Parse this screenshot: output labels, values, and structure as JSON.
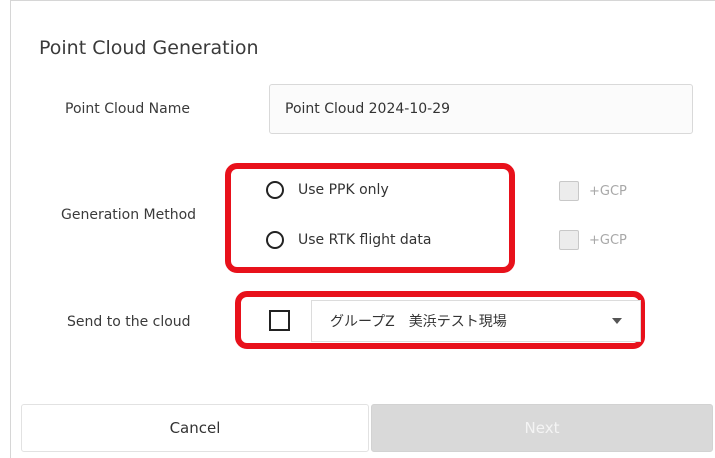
{
  "dialog": {
    "title": "Point Cloud Generation"
  },
  "point_cloud_name": {
    "label": "Point Cloud Name",
    "value": "Point Cloud 2024-10-29"
  },
  "generation_method": {
    "label": "Generation Method",
    "options": [
      {
        "label": "Use PPK only",
        "selected": false,
        "gcp_label": "+GCP",
        "gcp_enabled": false
      },
      {
        "label": "Use RTK flight data",
        "selected": false,
        "gcp_label": "+GCP",
        "gcp_enabled": false
      }
    ]
  },
  "send_to_cloud": {
    "label": "Send to the cloud",
    "checked": false,
    "selected_group": "グループZ　美浜テスト現場"
  },
  "buttons": {
    "cancel": "Cancel",
    "next": "Next"
  },
  "colors": {
    "highlight": "#e8111b",
    "disabled_button": "#d9d9d9"
  }
}
